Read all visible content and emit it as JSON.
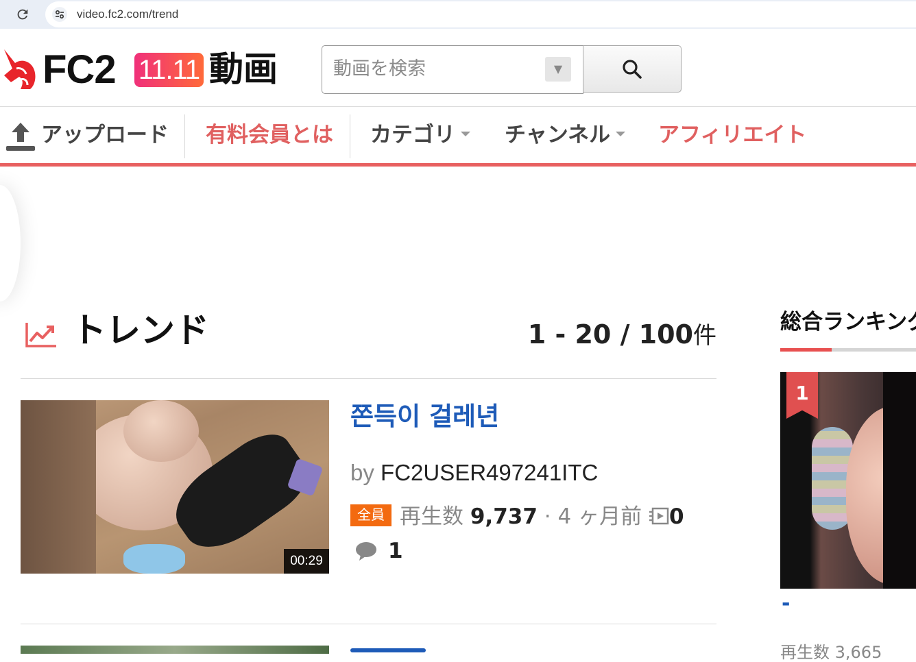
{
  "browser": {
    "url": "video.fc2.com/trend"
  },
  "header": {
    "logo_text": "FC2",
    "logo_badge": "11.11",
    "logo_suffix": "動画",
    "search_placeholder": "動画を検索"
  },
  "nav": {
    "items": [
      {
        "label": "アップロード",
        "color": "#444444"
      },
      {
        "label": "有料会員とは",
        "color": "#e06060"
      },
      {
        "label": "カテゴリ",
        "color": "#444444"
      },
      {
        "label": "チャンネル",
        "color": "#444444"
      },
      {
        "label": "アフィリエイト",
        "color": "#e06060"
      }
    ],
    "accent": "#e86060"
  },
  "main": {
    "title": "トレンド",
    "count_range": "1 - 20 / 100",
    "count_unit": "件",
    "videos": [
      {
        "title": "쫀득이 걸레년",
        "by": "by",
        "author": "FC2USER497241ITC",
        "badge": "全員",
        "views_label": "再生数",
        "views": "9,737",
        "sep": "·",
        "age": "4 ヶ月前",
        "playlist_count": "0",
        "comments": "1",
        "duration": "00:29"
      }
    ]
  },
  "sidebar": {
    "title": "総合ランキング",
    "rank": "1",
    "rank_title": "-",
    "next_text": "再生数 3,665"
  }
}
